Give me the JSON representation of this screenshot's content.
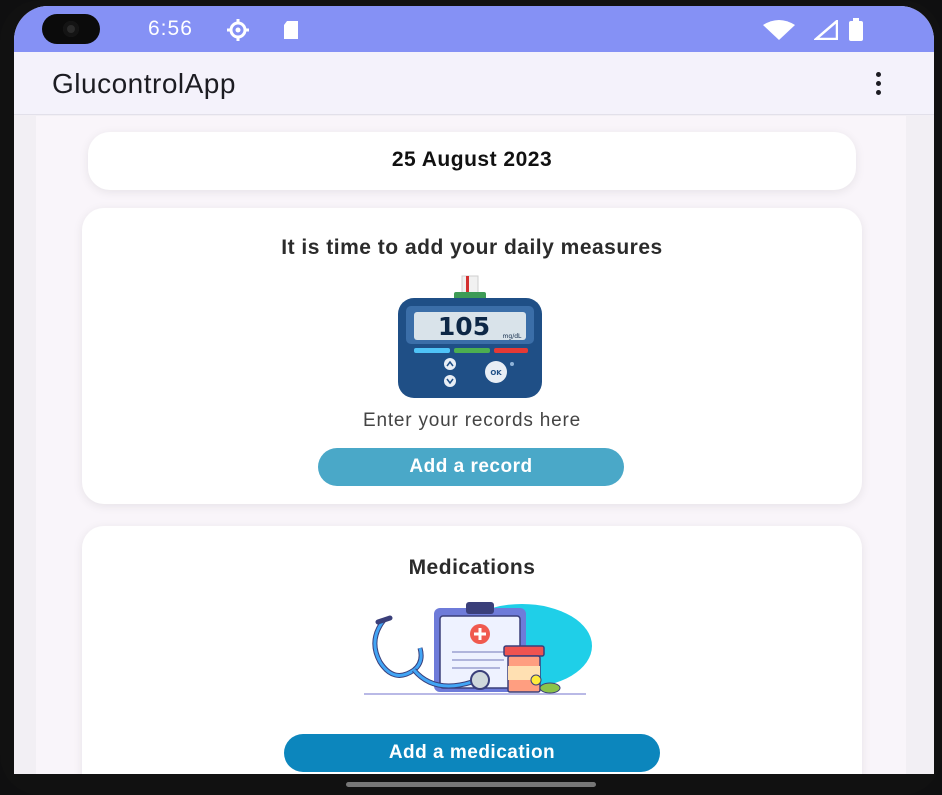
{
  "status_bar": {
    "time": "6:56",
    "icons": [
      "camera-cutout",
      "gear-icon",
      "sd-card-icon",
      "wifi-icon",
      "signal-icon",
      "battery-icon"
    ],
    "background": "#8591f5"
  },
  "app_bar": {
    "title": "GlucontrolApp",
    "menu_icon": "more-vert-icon"
  },
  "date_card": {
    "date": "25 August 2023"
  },
  "measures_card": {
    "title": "It is time to add your daily measures",
    "meter_reading": "105",
    "meter_unit": "mg/dL",
    "meter_ok_label": "OK",
    "subtitle": "Enter your records here",
    "button_label": "Add a record",
    "button_color": "#4aa8c8"
  },
  "medications_card": {
    "title": "Medications",
    "illustration": "medical-clipboard-stethoscope-pills",
    "button_label": "Add a medication",
    "button_color": "#0c86bd"
  }
}
